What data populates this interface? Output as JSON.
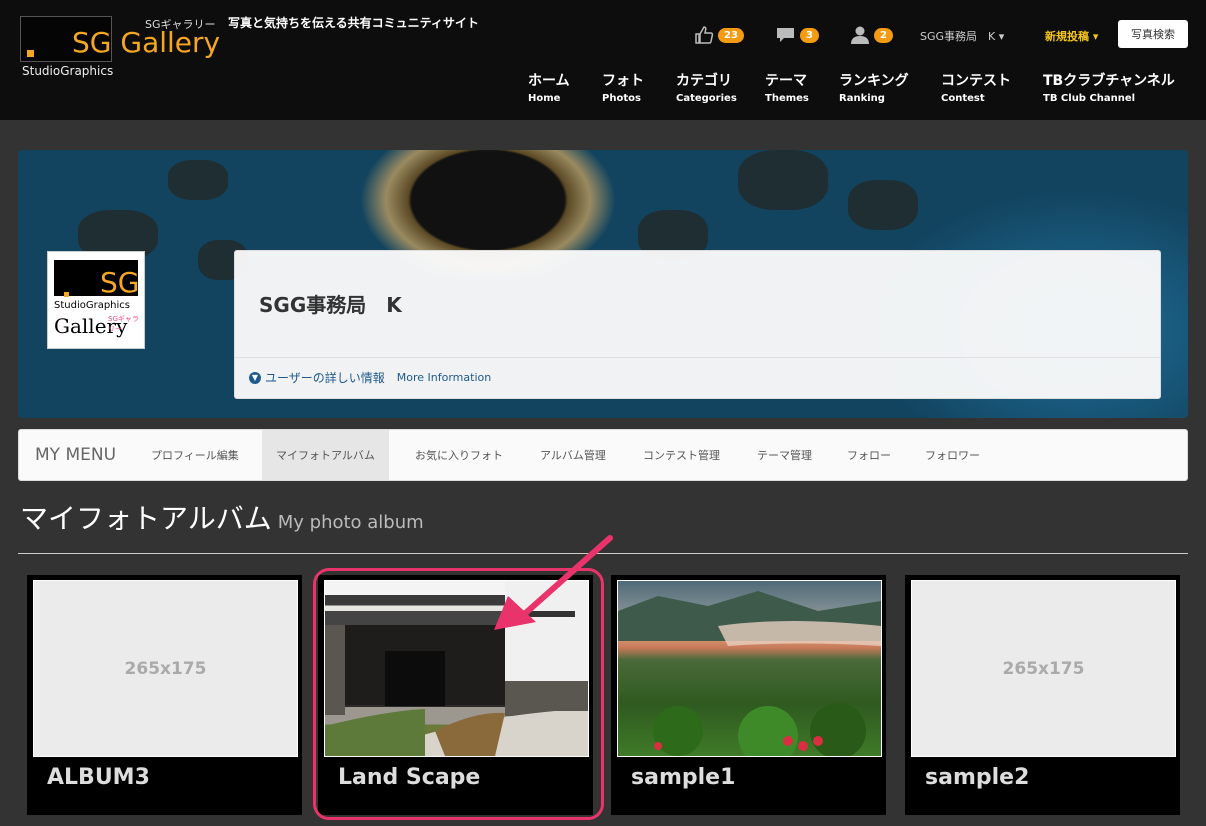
{
  "header": {
    "logo_sub_jp": "SGギャラリー",
    "logo_sg": "SG Gallery",
    "logo_name": "StudioGraphics",
    "tagline": "写真と気持ちを伝える共有コミュニティサイト",
    "likes_count": "23",
    "comments_count": "3",
    "followers_count": "2",
    "user_menu": "SGG事務局　K ▾",
    "new_post": "新規投稿 ▾",
    "search_button": "写真検索",
    "accent_color": "#f5a623"
  },
  "nav": [
    {
      "jp": "ホーム",
      "en": "Home"
    },
    {
      "jp": "フォト",
      "en": "Photos"
    },
    {
      "jp": "カテゴリ",
      "en": "Categories"
    },
    {
      "jp": "テーマ",
      "en": "Themes"
    },
    {
      "jp": "ランキング",
      "en": "Ranking"
    },
    {
      "jp": "コンテスト",
      "en": "Contest"
    },
    {
      "jp": "TBクラブチャンネル",
      "en": "TB Club Channel"
    }
  ],
  "profile": {
    "avatar_sg": "SG",
    "avatar_name": "StudioGraphics",
    "avatar_gallery": "Gallery",
    "avatar_gallery_jp": "SGギャラリー",
    "name": "SGG事務局　K",
    "more_jp": "ユーザーの詳しい情報",
    "more_en": "More Information"
  },
  "mymenu": {
    "title": "MY MENU",
    "items": [
      "プロフィール編集",
      "マイフォトアルバム",
      "お気に入りフォト",
      "アルバム管理",
      "コンテスト管理",
      "テーマ管理",
      "フォロー",
      "フォロワー"
    ],
    "active_index": 1
  },
  "page": {
    "title_jp": "マイフォトアルバム",
    "title_en": "My photo album"
  },
  "albums": [
    {
      "title": "ALBUM3",
      "thumb": "265x175"
    },
    {
      "title": "Land Scape",
      "thumb": ""
    },
    {
      "title": "sample1",
      "thumb": ""
    },
    {
      "title": "sample2",
      "thumb": "265x175"
    }
  ],
  "annotation_color": "#e8336b"
}
